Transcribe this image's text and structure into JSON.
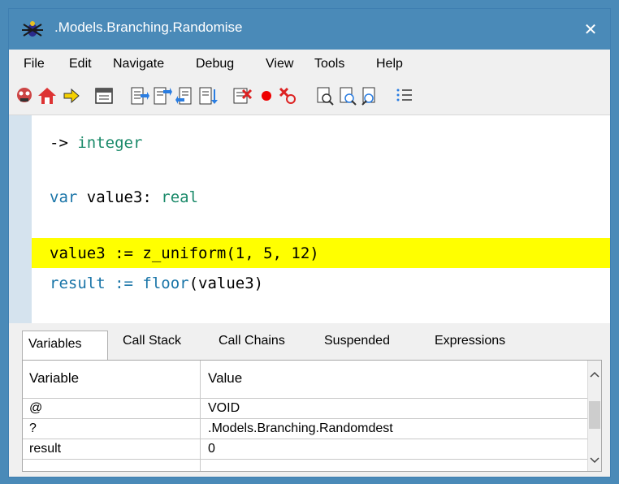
{
  "window": {
    "title": ".Models.Branching.Randomise",
    "close_glyph": "✕"
  },
  "menu": {
    "items": [
      "File",
      "Edit",
      "Navigate",
      "Debug",
      "View",
      "Tools",
      "Help"
    ]
  },
  "toolbar": {
    "icons": [
      "bug-mask-icon",
      "home-icon",
      "arrow-right-icon",
      "calendar-icon",
      "step-into-icon",
      "step-over-icon",
      "step-out-icon",
      "run-to-cursor-icon",
      "stop-icon",
      "breakpoint-icon",
      "clear-breakpoints-icon",
      "find-icon",
      "find-next-icon",
      "find-prev-icon",
      "list-icon"
    ]
  },
  "code": {
    "line1": {
      "arrow": "-> ",
      "type": "integer"
    },
    "line2": {
      "kw": "var",
      "name": " value3: ",
      "type": "real"
    },
    "line3": {
      "text": "value3 := z_uniform(1, 5, 12)"
    },
    "line4": {
      "lhs": "result := ",
      "fn": "floor",
      "rest": "(value3)"
    }
  },
  "highlight_color": "#ffff00",
  "tabs": {
    "items": [
      "Variables",
      "Call Stack",
      "Call Chains",
      "Suspended",
      "Expressions"
    ],
    "active": "Variables"
  },
  "variables": {
    "headers": {
      "variable": "Variable",
      "value": "Value"
    },
    "rows": [
      {
        "variable": "@",
        "value": "VOID"
      },
      {
        "variable": "?",
        "value": ".Models.Branching.Randomdest"
      },
      {
        "variable": "result",
        "value": "0"
      }
    ]
  }
}
